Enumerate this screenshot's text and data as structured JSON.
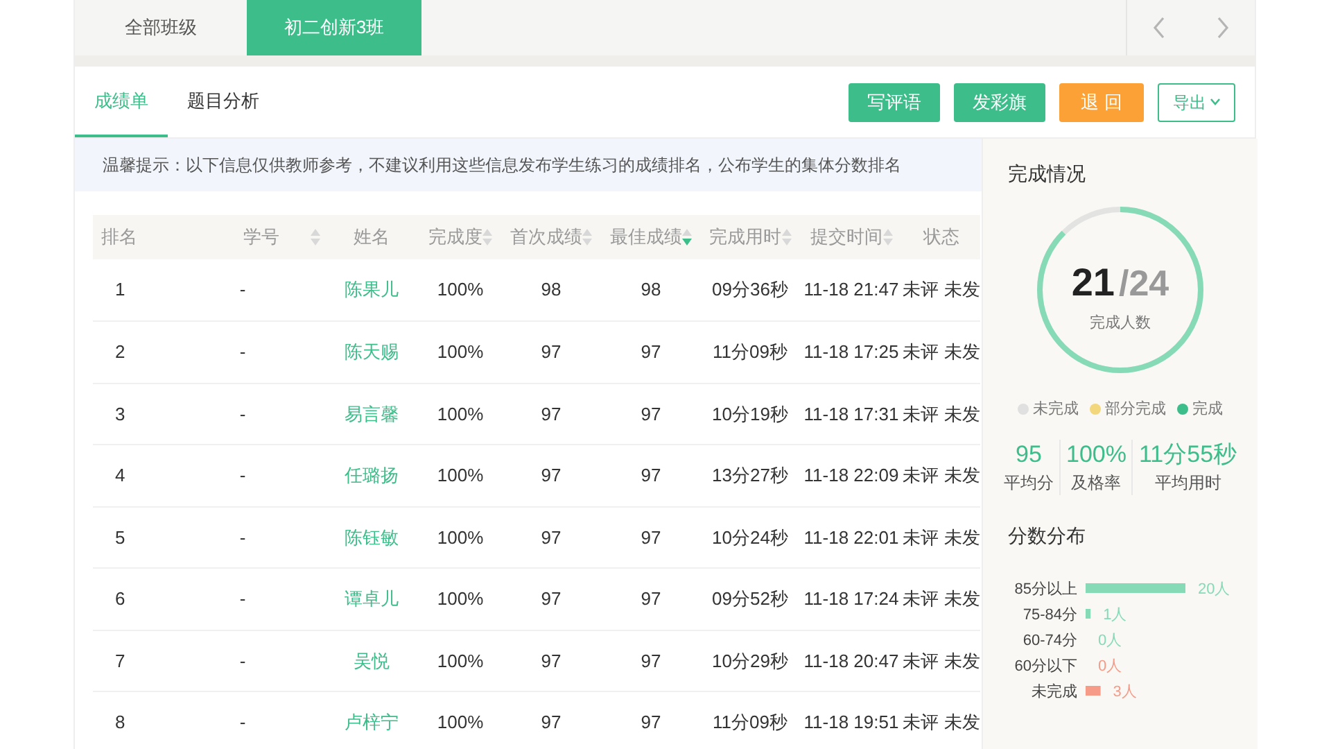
{
  "class_tabs": [
    {
      "label": "全部班级",
      "selected": false
    },
    {
      "label": "初二创新3班",
      "selected": true
    }
  ],
  "sub_tabs": [
    {
      "label": "成绩单",
      "selected": true
    },
    {
      "label": "题目分析",
      "selected": false
    }
  ],
  "actions": [
    {
      "label": "写评语",
      "kind": "green"
    },
    {
      "label": "发彩旗",
      "kind": "green"
    },
    {
      "label": "退 回",
      "kind": "orange"
    },
    {
      "label": "导出",
      "kind": "outline"
    }
  ],
  "notice": "温馨提示：以下信息仅供教师参考，不建议利用这些信息发布学生练习的成绩排名，公布学生的集体分数排名",
  "table": {
    "columns": [
      {
        "label": "排名"
      },
      {
        "label": "学号",
        "sortable": true,
        "sorted": false
      },
      {
        "label": "姓名"
      },
      {
        "label": "完成度",
        "sortable": true,
        "sorted": false
      },
      {
        "label": "首次成绩",
        "sortable": true,
        "sorted": false
      },
      {
        "label": "最佳成绩",
        "sortable": true,
        "sorted": true
      },
      {
        "label": "完成用时",
        "sortable": true,
        "sorted": false
      },
      {
        "label": "提交时间",
        "sortable": true,
        "sorted": false
      },
      {
        "label": "状态"
      }
    ],
    "rows": [
      [
        "1",
        "-",
        "陈果儿",
        "100%",
        "98",
        "98",
        "09分36秒",
        "11-18 21:47",
        "未评 未发"
      ],
      [
        "2",
        "-",
        "陈天赐",
        "100%",
        "97",
        "97",
        "11分09秒",
        "11-18 17:25",
        "未评 未发"
      ],
      [
        "3",
        "-",
        "易言馨",
        "100%",
        "97",
        "97",
        "10分19秒",
        "11-18 17:31",
        "未评 未发"
      ],
      [
        "4",
        "-",
        "任璐扬",
        "100%",
        "97",
        "97",
        "13分27秒",
        "11-18 22:09",
        "未评 未发"
      ],
      [
        "5",
        "-",
        "陈钰敏",
        "100%",
        "97",
        "97",
        "10分24秒",
        "11-18 22:01",
        "未评 未发"
      ],
      [
        "6",
        "-",
        "谭卓儿",
        "100%",
        "97",
        "97",
        "09分52秒",
        "11-18 17:24",
        "未评 未发"
      ],
      [
        "7",
        "-",
        "吴悦",
        "100%",
        "97",
        "97",
        "10分29秒",
        "11-18 20:47",
        "未评 未发"
      ],
      [
        "8",
        "-",
        "卢梓宁",
        "100%",
        "97",
        "97",
        "11分09秒",
        "11-18 19:51",
        "未评 未发"
      ]
    ]
  },
  "completion": {
    "title": "完成情况",
    "done": "21",
    "total": "/24",
    "caption": "完成人数",
    "level": 0.875,
    "legend": [
      {
        "label": "未完成",
        "color": "#e0e0e0"
      },
      {
        "label": "部分完成",
        "color": "#f3d77c"
      },
      {
        "label": "完成",
        "color": "#3dbd8a"
      }
    ],
    "stats": [
      {
        "value": "95",
        "label": "平均分"
      },
      {
        "value": "100%",
        "label": "及格率"
      },
      {
        "value": "11分55秒",
        "label": "平均用时"
      }
    ]
  },
  "distribution": {
    "title": "分数分布",
    "chart_data": {
      "type": "bar",
      "orientation": "horizontal",
      "categories": [
        "85分以上",
        "75-84分",
        "60-74分",
        "60分以下",
        "未完成"
      ],
      "data_labels": true,
      "series": [
        {
          "color": "#86dab6",
          "values": [
            20,
            1,
            0,
            null,
            null
          ],
          "value_labels": [
            "20人",
            "1人",
            "0人",
            null,
            null
          ]
        },
        {
          "color": "#f59b87",
          "values": [
            null,
            null,
            null,
            0,
            3
          ],
          "value_labels": [
            null,
            null,
            null,
            "0人",
            "3人"
          ]
        }
      ]
    }
  }
}
